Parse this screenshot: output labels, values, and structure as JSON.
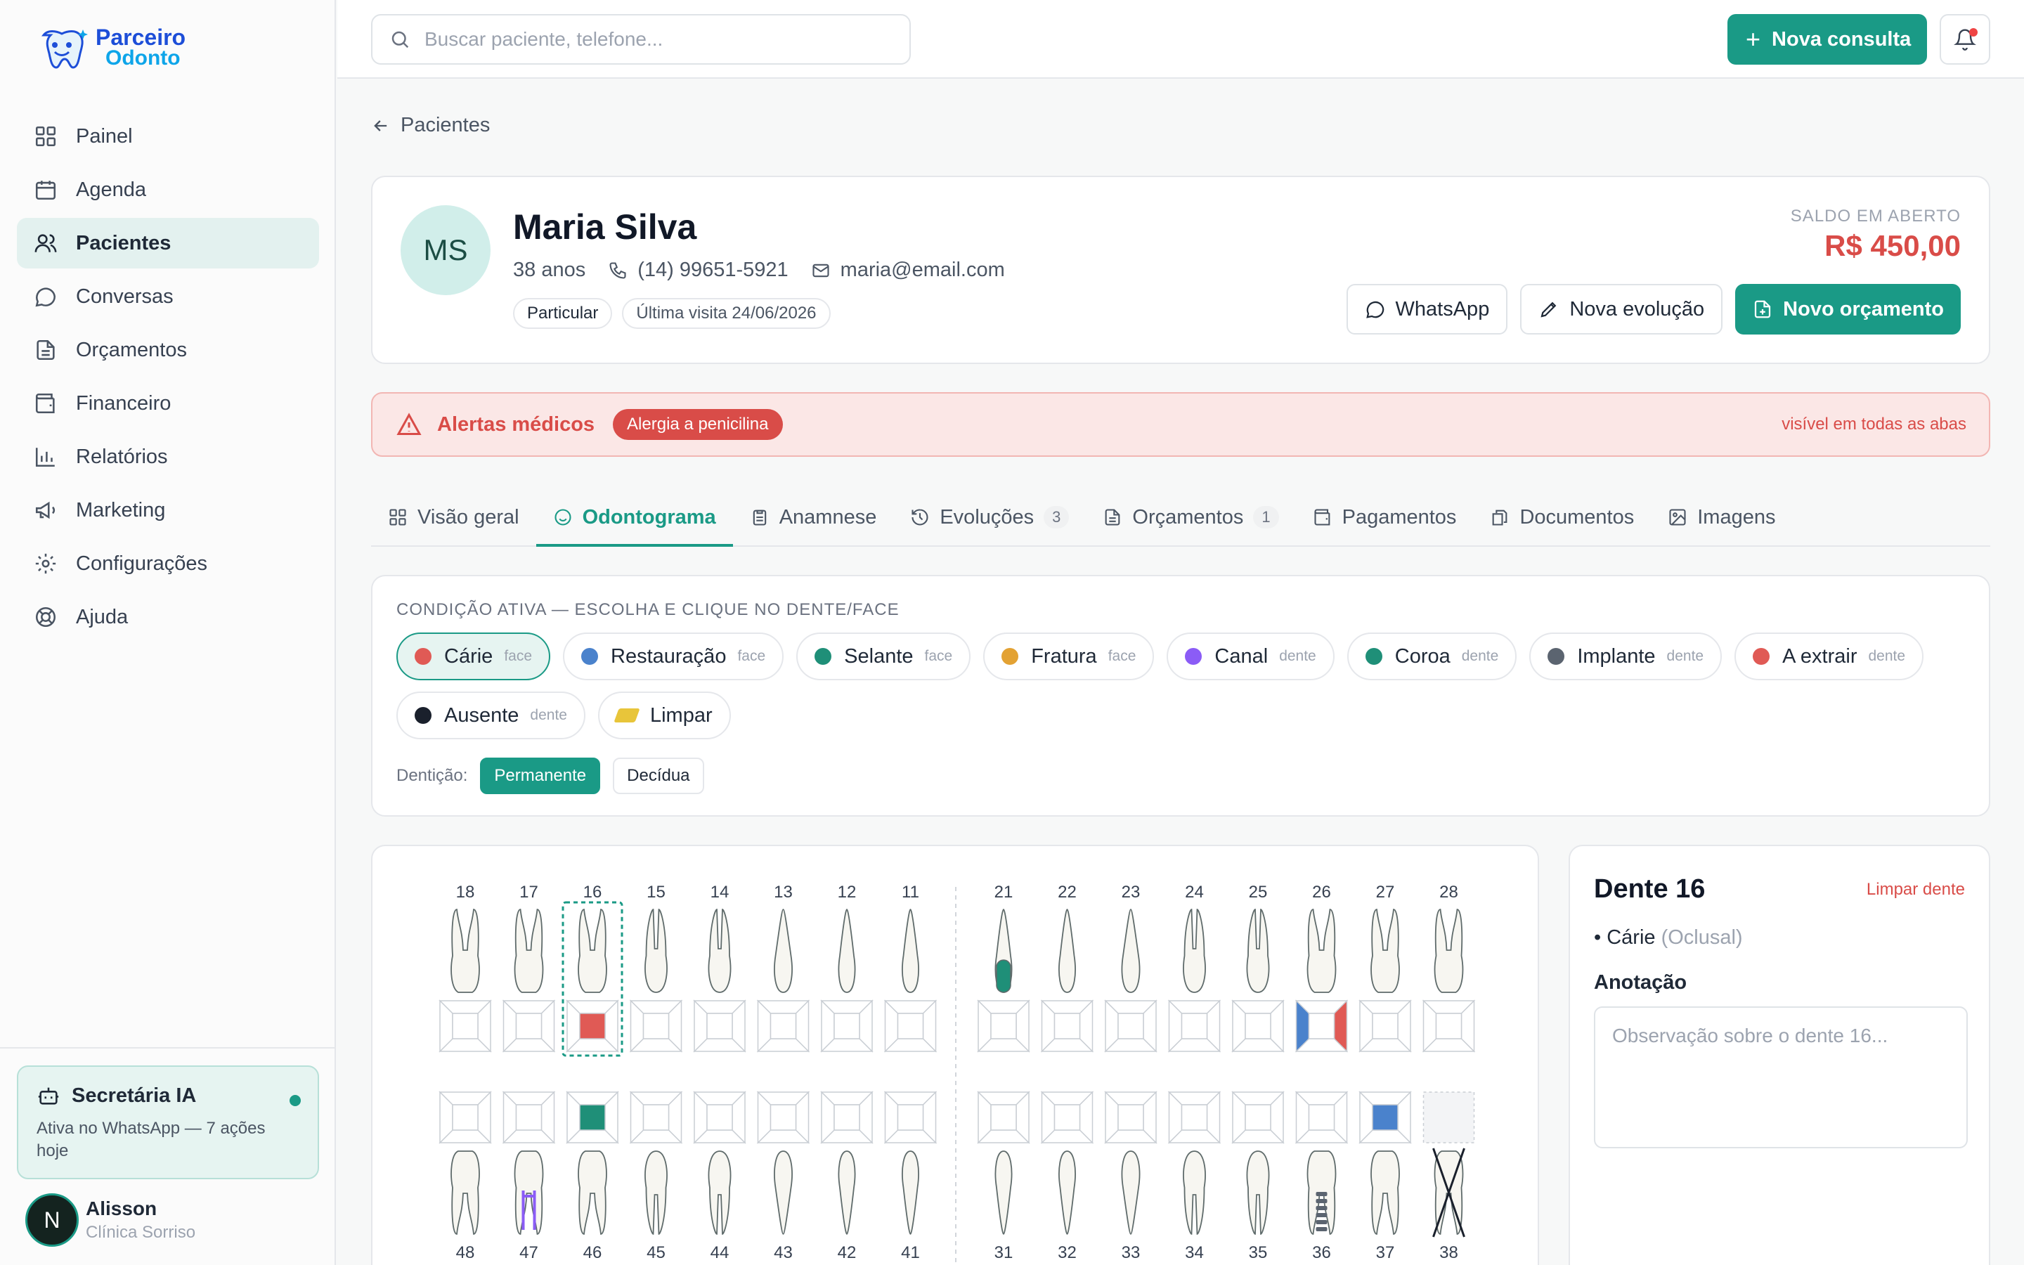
{
  "sidebar": {
    "logo": {
      "line1": "Parceiro",
      "line2": "Odonto"
    },
    "items": [
      {
        "label": "Painel",
        "icon": "grid-icon"
      },
      {
        "label": "Agenda",
        "icon": "calendar-icon"
      },
      {
        "label": "Pacientes",
        "icon": "users-icon"
      },
      {
        "label": "Conversas",
        "icon": "chat-icon"
      },
      {
        "label": "Orçamentos",
        "icon": "file-text-icon"
      },
      {
        "label": "Financeiro",
        "icon": "wallet-icon"
      },
      {
        "label": "Relatórios",
        "icon": "bar-chart-icon"
      },
      {
        "label": "Marketing",
        "icon": "megaphone-icon"
      },
      {
        "label": "Configurações",
        "icon": "gear-icon"
      },
      {
        "label": "Ajuda",
        "icon": "lifebuoy-icon"
      }
    ],
    "active_item": "Pacientes",
    "ai": {
      "title": "Secretária IA",
      "subtitle": "Ativa no WhatsApp — 7 ações hoje"
    },
    "user": {
      "initial": "N",
      "name": "Alisson",
      "clinic": "Clínica Sorriso"
    }
  },
  "topbar": {
    "search_placeholder": "Buscar paciente, telefone...",
    "new_appointment": "Nova consulta"
  },
  "breadcrumb": {
    "back_label": "Pacientes"
  },
  "patient": {
    "initials": "MS",
    "name": "Maria Silva",
    "age": "38 anos",
    "phone": "(14) 99651-5921",
    "email": "maria@email.com",
    "tags": [
      "Particular",
      "Última visita 24/06/2026"
    ],
    "balance_label": "SALDO EM ABERTO",
    "balance_value": "R$ 450,00",
    "actions": {
      "whatsapp": "WhatsApp",
      "new_evolution": "Nova evolução",
      "new_quote": "Novo orçamento"
    }
  },
  "alert": {
    "title": "Alertas médicos",
    "badge": "Alergia a penicilina",
    "note": "visível em todas as abas"
  },
  "tabs": [
    {
      "label": "Visão geral",
      "icon": "grid-icon",
      "count": ""
    },
    {
      "label": "Odontograma",
      "icon": "smile-icon",
      "count": ""
    },
    {
      "label": "Anamnese",
      "icon": "clipboard-icon",
      "count": ""
    },
    {
      "label": "Evoluções",
      "icon": "history-icon",
      "count": "3"
    },
    {
      "label": "Orçamentos",
      "icon": "file-text-icon",
      "count": "1"
    },
    {
      "label": "Pagamentos",
      "icon": "wallet-icon",
      "count": ""
    },
    {
      "label": "Documentos",
      "icon": "documents-icon",
      "count": ""
    },
    {
      "label": "Imagens",
      "icon": "image-icon",
      "count": ""
    }
  ],
  "active_tab": "Odontograma",
  "conditions": {
    "label": "CONDIÇÃO ATIVA — ESCOLHA E CLIQUE NO DENTE/FACE",
    "items": [
      {
        "label": "Cárie",
        "kind": "face",
        "color": "#e05a55"
      },
      {
        "label": "Restauração",
        "kind": "face",
        "color": "#4a82cc"
      },
      {
        "label": "Selante",
        "kind": "face",
        "color": "#1f8f78"
      },
      {
        "label": "Fratura",
        "kind": "face",
        "color": "#e3a233"
      },
      {
        "label": "Canal",
        "kind": "dente",
        "color": "#8b5cf6"
      },
      {
        "label": "Coroa",
        "kind": "dente",
        "color": "#1f8f78"
      },
      {
        "label": "Implante",
        "kind": "dente",
        "color": "#5b6470"
      },
      {
        "label": "A extrair",
        "kind": "dente",
        "color": "#e05a55"
      },
      {
        "label": "Ausente",
        "kind": "dente",
        "color": "#1a202c"
      },
      {
        "label": "Limpar",
        "kind": "",
        "color": ""
      }
    ],
    "active": "Cárie",
    "dentition_label": "Dentição:",
    "dentition_options": [
      "Permanente",
      "Decídua"
    ],
    "dentition_active": "Permanente"
  },
  "odontogram": {
    "upper_right": [
      "18",
      "17",
      "16",
      "15",
      "14",
      "13",
      "12",
      "11"
    ],
    "upper_left": [
      "21",
      "22",
      "23",
      "24",
      "25",
      "26",
      "27",
      "28"
    ],
    "lower_right": [
      "48",
      "47",
      "46",
      "45",
      "44",
      "43",
      "42",
      "41"
    ],
    "lower_left": [
      "31",
      "32",
      "33",
      "34",
      "35",
      "36",
      "37",
      "38"
    ],
    "selected_tooth": "16",
    "marks": [
      {
        "tooth": "16",
        "face": "center",
        "condition": "Cárie"
      },
      {
        "tooth": "21",
        "face": "crown",
        "condition": "Coroa"
      },
      {
        "tooth": "26",
        "face": "left",
        "condition": "Restauração"
      },
      {
        "tooth": "26",
        "face": "right",
        "condition": "Cárie"
      },
      {
        "tooth": "46",
        "face": "center",
        "condition": "Selante"
      },
      {
        "tooth": "37",
        "face": "center",
        "condition": "Restauração"
      },
      {
        "tooth": "47",
        "face": "root",
        "condition": "Canal"
      },
      {
        "tooth": "36",
        "face": "root",
        "condition": "Implante"
      },
      {
        "tooth": "38",
        "face": "tooth",
        "condition": "Ausente"
      }
    ]
  },
  "tooth_detail": {
    "title": "Dente 16",
    "clear_label": "Limpar dente",
    "finding": "• Cárie",
    "finding_face": "(Oclusal)",
    "note_label": "Anotação",
    "note_placeholder": "Observação sobre o dente 16..."
  }
}
